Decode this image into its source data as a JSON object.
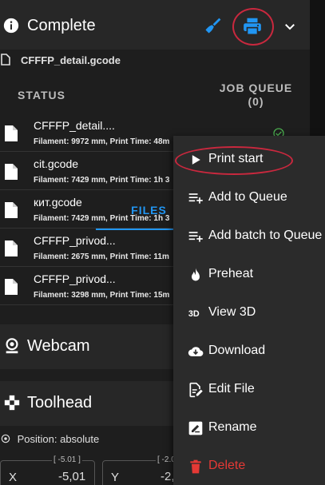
{
  "status_header": {
    "title": "Complete",
    "icons": [
      "info-icon",
      "broom-icon",
      "printer-icon",
      "chevron-down-icon"
    ],
    "accent": "#2196f3"
  },
  "current_file": "CFFFP_detail.gcode",
  "tabs": [
    {
      "label": "STATUS",
      "active": false
    },
    {
      "label": "FILES",
      "active": true
    },
    {
      "label": "JOB QUEUE\n(0)",
      "active": false
    }
  ],
  "files": [
    {
      "name": "CFFFP_detail....",
      "meta": "Filament: 9972 mm, Print Time: 48m",
      "done": true
    },
    {
      "name": "cit.gcode",
      "meta": "Filament: 7429 mm, Print Time: 1h 3",
      "done": false
    },
    {
      "name": "кит.gcode",
      "meta": "Filament: 7429 mm, Print Time: 1h 3",
      "done": false
    },
    {
      "name": "CFFFP_privod...",
      "meta": "Filament: 2675 mm, Print Time: 11m",
      "done": false
    },
    {
      "name": "CFFFP_privod...",
      "meta": "Filament: 3298 mm, Print Time: 15m",
      "done": false
    }
  ],
  "sections": {
    "webcam": "Webcam",
    "toolhead": "Toolhead"
  },
  "toolhead": {
    "position_label": "Position: absolute",
    "x": {
      "axis": "X",
      "target": "[ -5.01 ]",
      "value": "-5,01"
    },
    "y": {
      "axis": "Y",
      "target": "[ -2.0",
      "value": "-2,"
    }
  },
  "context_menu": [
    {
      "label": "Print start",
      "icon": "play-icon"
    },
    {
      "label": "Add to Queue",
      "icon": "playlist-add-icon"
    },
    {
      "label": "Add batch to Queue",
      "icon": "playlist-add-icon"
    },
    {
      "label": "Preheat",
      "icon": "fire-icon"
    },
    {
      "label": "View 3D",
      "icon": "3d-icon"
    },
    {
      "label": "Download",
      "icon": "cloud-download-icon"
    },
    {
      "label": "Edit File",
      "icon": "file-edit-icon"
    },
    {
      "label": "Rename",
      "icon": "rename-icon"
    },
    {
      "label": "Delete",
      "icon": "trash-icon"
    }
  ],
  "colors": {
    "annotation": "#c9283e",
    "delete": "#e53935",
    "success": "#4caf50"
  }
}
